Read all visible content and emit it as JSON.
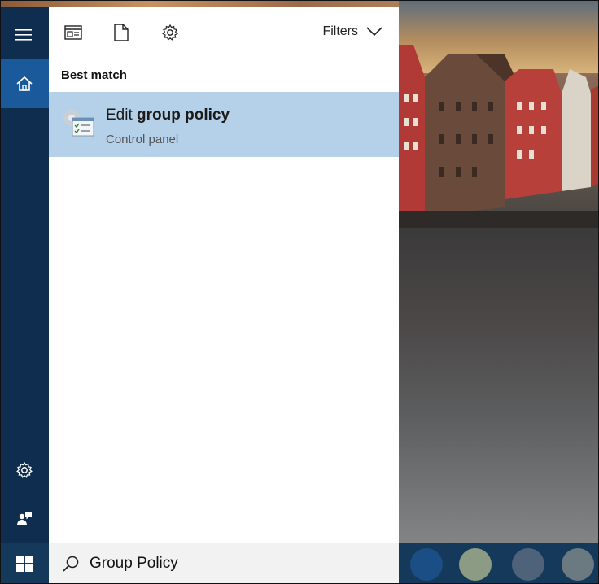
{
  "rail": {
    "menu_icon": "hamburger-icon",
    "home_icon": "home-icon",
    "settings_icon": "gear-icon",
    "feedback_icon": "feedback-icon"
  },
  "toolbar": {
    "apps_icon": "apps-filter-icon",
    "documents_icon": "document-filter-icon",
    "settings_icon": "settings-filter-icon",
    "filters_label": "Filters"
  },
  "results": {
    "section_label": "Best match",
    "items": [
      {
        "title_prefix": "Edit ",
        "title_bold": "group policy",
        "subtitle": "Control panel",
        "icon": "group-policy-icon"
      }
    ]
  },
  "search": {
    "value": "Group Policy",
    "icon": "search-icon"
  },
  "taskbar": {
    "start_icon": "windows-logo-icon",
    "pinned_colors": [
      "#1b4e84",
      "#8c9c84",
      "#4e627a",
      "#6a7a80"
    ]
  },
  "colors": {
    "rail": "#0f2d4f",
    "rail_active": "#1b5a9a",
    "selection": "#b5d1e9",
    "taskbar": "#14395a"
  }
}
